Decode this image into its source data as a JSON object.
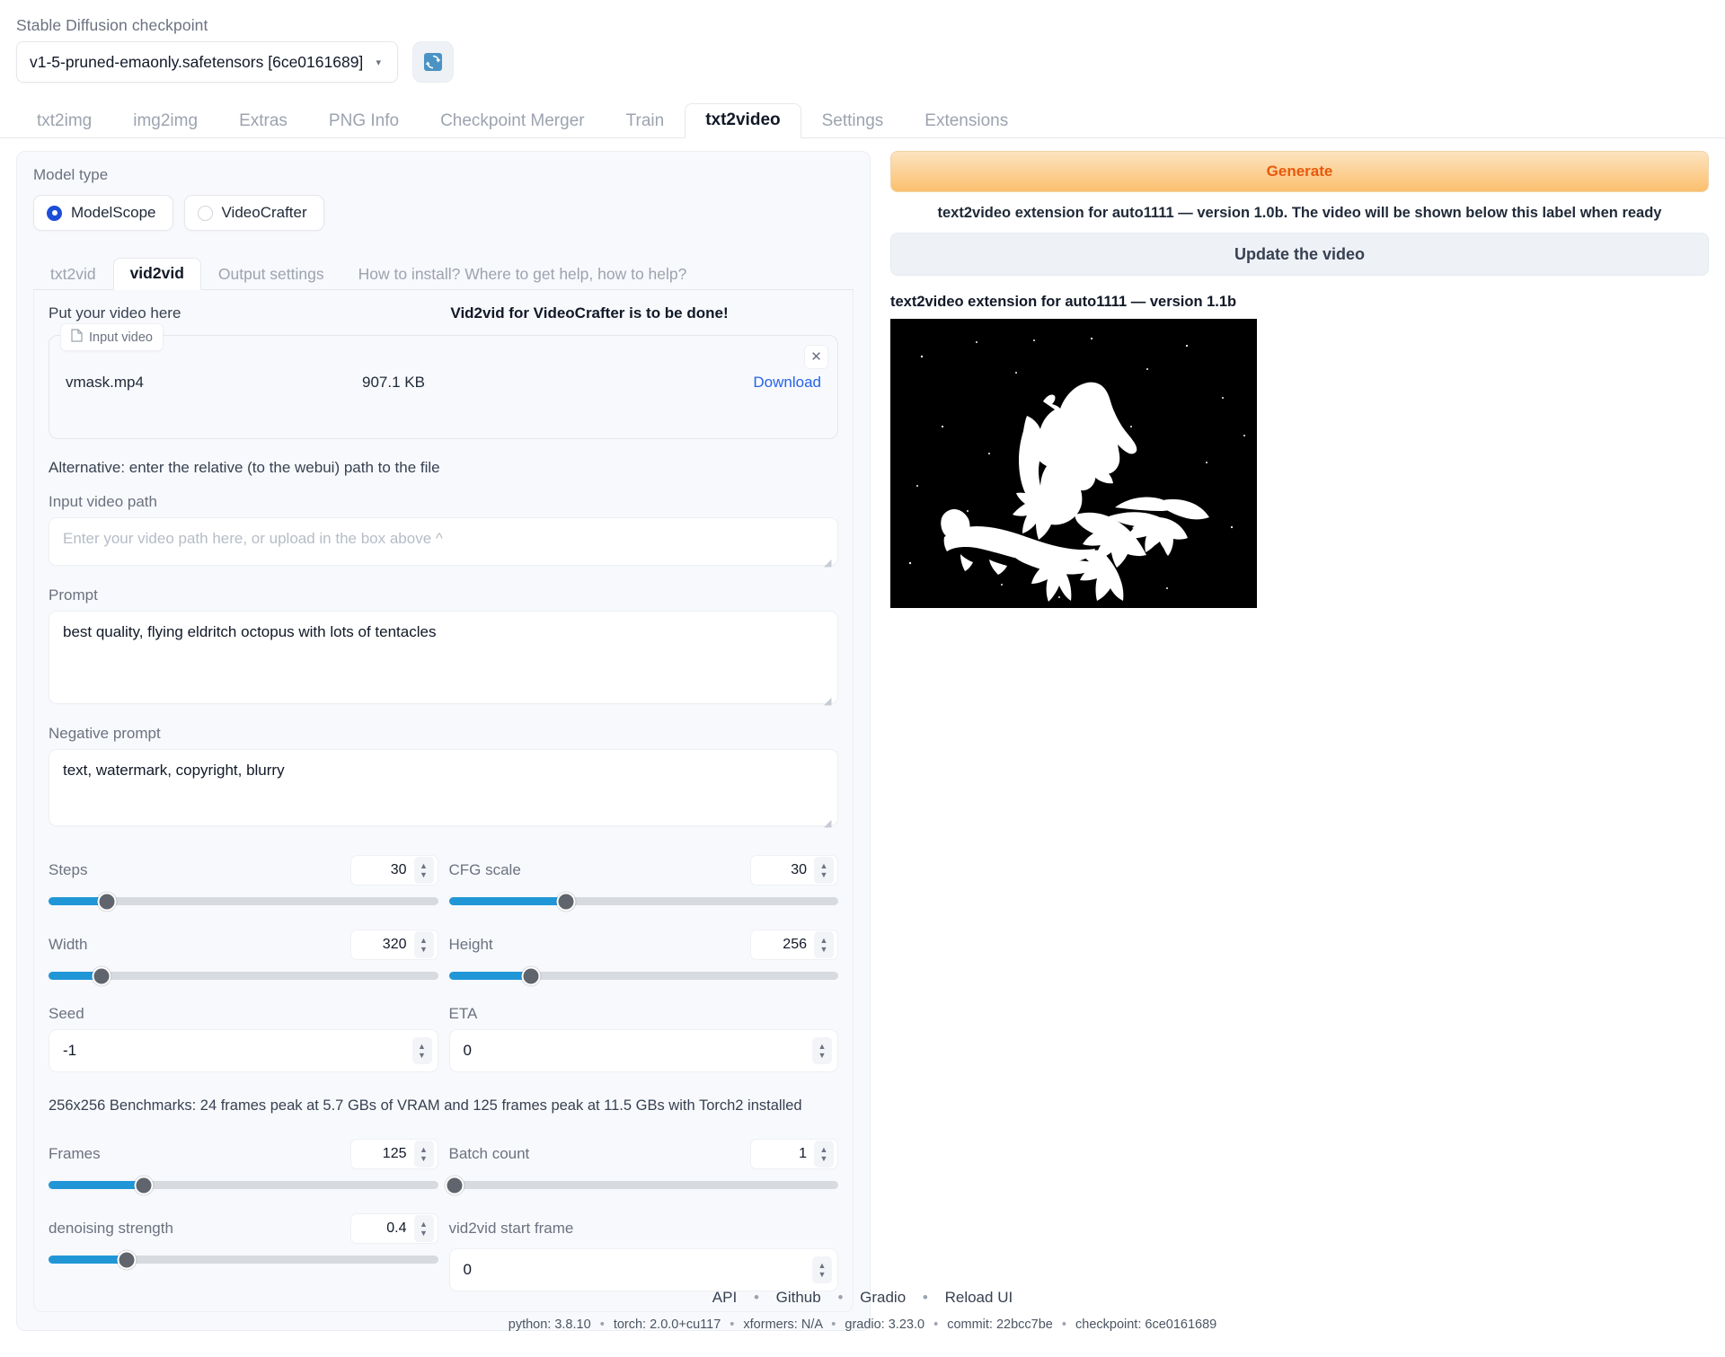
{
  "checkpoint": {
    "label": "Stable Diffusion checkpoint",
    "value": "v1-5-pruned-emaonly.safetensors [6ce0161689]",
    "caret": "▾",
    "refresh_icon": "refresh-icon"
  },
  "main_tabs": [
    {
      "label": "txt2img",
      "active": false
    },
    {
      "label": "img2img",
      "active": false
    },
    {
      "label": "Extras",
      "active": false
    },
    {
      "label": "PNG Info",
      "active": false
    },
    {
      "label": "Checkpoint Merger",
      "active": false
    },
    {
      "label": "Train",
      "active": false
    },
    {
      "label": "txt2video",
      "active": true
    },
    {
      "label": "Settings",
      "active": false
    },
    {
      "label": "Extensions",
      "active": false
    }
  ],
  "model_type": {
    "label": "Model type",
    "options": [
      {
        "label": "ModelScope",
        "selected": true
      },
      {
        "label": "VideoCrafter",
        "selected": false
      }
    ]
  },
  "inner_tabs": [
    {
      "label": "txt2vid",
      "active": false
    },
    {
      "label": "vid2vid",
      "active": true
    },
    {
      "label": "Output settings",
      "active": false
    },
    {
      "label": "How to install? Where to get help, how to help?",
      "active": false
    }
  ],
  "vid2vid": {
    "put_video_here": "Put your video here",
    "note": "Vid2vid for VideoCrafter is to be done!",
    "file_tag": "Input video",
    "file_name": "vmask.mp4",
    "file_size": "907.1 KB",
    "download_label": "Download",
    "close_label": "✕",
    "alt_note": "Alternative: enter the relative (to the webui) path to the file",
    "input_path_label": "Input video path",
    "input_path_value": "",
    "input_path_placeholder": "Enter your video path here, or upload in the box above ^",
    "prompt_label": "Prompt",
    "prompt_value": "best quality, flying eldritch octopus with lots of tentacles",
    "negative_label": "Negative prompt",
    "negative_value": "text, watermark, copyright, blurry",
    "benchmarks": "256x256 Benchmarks: 24 frames peak at 5.7 GBs of VRAM and 125 frames peak at 11.5 GBs with Torch2 installed"
  },
  "sliders": [
    {
      "name": "Steps",
      "value": "30",
      "fill_pct": 15
    },
    {
      "name": "CFG scale",
      "value": "30",
      "fill_pct": 30
    },
    {
      "name": "Width",
      "value": "320",
      "fill_pct": 13.5
    },
    {
      "name": "Height",
      "value": "256",
      "fill_pct": 21
    },
    {
      "name": "Frames",
      "value": "125",
      "fill_pct": 24.5
    },
    {
      "name": "Batch count",
      "value": "1",
      "fill_pct": 1
    },
    {
      "name": "denoising strength",
      "value": "0.4",
      "fill_pct": 20
    }
  ],
  "fields": {
    "seed_label": "Seed",
    "seed_value": "-1",
    "eta_label": "ETA",
    "eta_value": "0",
    "start_frame_label": "vid2vid start frame",
    "start_frame_value": "0"
  },
  "right": {
    "generate_label": "Generate",
    "generate_note": "text2video extension for auto1111 — version 1.0b. The video will be shown below this label when ready",
    "update_label": "Update the video",
    "version_label": "text2video extension for auto1111 — version 1.1b",
    "video_alt": "white witch riding broomstick silhouette on black background"
  },
  "footer": {
    "links": [
      "API",
      "Github",
      "Gradio",
      "Reload UI"
    ],
    "separator": "•",
    "versions": [
      "python: 3.8.10",
      "torch: 2.0.0+cu117",
      "xformers: N/A",
      "gradio: 3.23.0",
      "commit: 22bcc7be",
      "checkpoint: 6ce0161689"
    ]
  },
  "colors": {
    "accent_blue": "#2196d6",
    "radio_blue": "#1d4ed8",
    "link_blue": "#2563eb",
    "generate_orange": "#e8590c"
  }
}
